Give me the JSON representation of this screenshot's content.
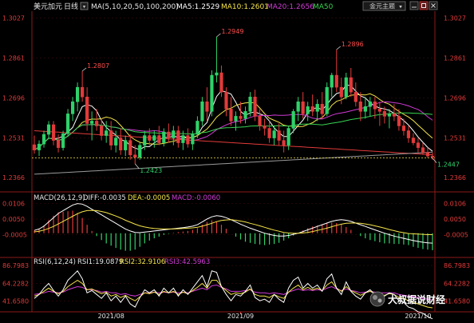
{
  "header": {
    "symbol": "美元加元",
    "period": "日线",
    "ma_label": "MA(5,10,20,50,100,200)",
    "ma5": "MA5:1.2529",
    "ma10": "MA10:1.2601",
    "ma20": "MA20:1.2656",
    "ma50": "MA50",
    "theme_button": "金元主题",
    "colors": {
      "ma5": "#ffffff",
      "ma10": "#f5e44a",
      "ma20": "#d13bd6",
      "ma50": "#39d353"
    }
  },
  "watermark": "大叔据说财经",
  "chart_data": [
    {
      "type": "candlestick",
      "title": "美元加元 日线",
      "x_ticks": [
        "2021/08",
        "2021/09",
        "2021/10"
      ],
      "y_ticks_left": [
        "1.3027",
        "1.2861",
        "1.2696",
        "1.2531",
        "1.2366"
      ],
      "y_ticks_right": [
        "1.3027",
        "1.2861",
        "1.2696",
        "1.2531",
        "1.2366"
      ],
      "ylim": [
        1.232,
        1.3055
      ],
      "annotations": [
        {
          "label": "1.2807",
          "bar": 10
        },
        {
          "label": "1.2423",
          "bar": 21
        },
        {
          "label": "1.2949",
          "bar": 38
        },
        {
          "label": "1.2896",
          "bar": 63
        },
        {
          "label": "1.2447",
          "bar": 83
        }
      ],
      "current_price": 1.2447,
      "candles": [
        [
          1.2502,
          1.254,
          1.2465,
          1.248
        ],
        [
          1.248,
          1.252,
          1.2455,
          1.2505
        ],
        [
          1.2505,
          1.256,
          1.249,
          1.2545
        ],
        [
          1.2545,
          1.26,
          1.2525,
          1.2585
        ],
        [
          1.2585,
          1.26,
          1.25,
          1.252
        ],
        [
          1.252,
          1.2545,
          1.247,
          1.249
        ],
        [
          1.249,
          1.256,
          1.2478,
          1.2548
        ],
        [
          1.2548,
          1.265,
          1.2535,
          1.263
        ],
        [
          1.263,
          1.27,
          1.26,
          1.268
        ],
        [
          1.268,
          1.276,
          1.264,
          1.274
        ],
        [
          1.274,
          1.2807,
          1.268,
          1.27
        ],
        [
          1.27,
          1.274,
          1.256,
          1.259
        ],
        [
          1.259,
          1.264,
          1.252,
          1.26
        ],
        [
          1.26,
          1.265,
          1.256,
          1.258
        ],
        [
          1.258,
          1.261,
          1.252,
          1.254
        ],
        [
          1.254,
          1.26,
          1.251,
          1.256
        ],
        [
          1.256,
          1.26,
          1.248,
          1.25
        ],
        [
          1.25,
          1.256,
          1.247,
          1.253
        ],
        [
          1.253,
          1.257,
          1.246,
          1.248
        ],
        [
          1.248,
          1.254,
          1.2455,
          1.252
        ],
        [
          1.252,
          1.2545,
          1.244,
          1.246
        ],
        [
          1.246,
          1.25,
          1.2423,
          1.245
        ],
        [
          1.245,
          1.251,
          1.244,
          1.25
        ],
        [
          1.25,
          1.256,
          1.248,
          1.254
        ],
        [
          1.254,
          1.257,
          1.25,
          1.252
        ],
        [
          1.252,
          1.256,
          1.249,
          1.254
        ],
        [
          1.254,
          1.258,
          1.25,
          1.251
        ],
        [
          1.251,
          1.257,
          1.2495,
          1.2555
        ],
        [
          1.2555,
          1.259,
          1.251,
          1.253
        ],
        [
          1.253,
          1.258,
          1.25,
          1.256
        ],
        [
          1.256,
          1.258,
          1.249,
          1.251
        ],
        [
          1.251,
          1.256,
          1.248,
          1.254
        ],
        [
          1.254,
          1.257,
          1.249,
          1.2505
        ],
        [
          1.2505,
          1.256,
          1.248,
          1.2545
        ],
        [
          1.2545,
          1.262,
          1.253,
          1.26
        ],
        [
          1.26,
          1.27,
          1.258,
          1.268
        ],
        [
          1.268,
          1.274,
          1.26,
          1.264
        ],
        [
          1.264,
          1.281,
          1.262,
          1.279
        ],
        [
          1.279,
          1.2949,
          1.276,
          1.28
        ],
        [
          1.28,
          1.283,
          1.27,
          1.272
        ],
        [
          1.272,
          1.274,
          1.262,
          1.265
        ],
        [
          1.265,
          1.27,
          1.258,
          1.26
        ],
        [
          1.26,
          1.264,
          1.256,
          1.262
        ],
        [
          1.262,
          1.268,
          1.259,
          1.261
        ],
        [
          1.261,
          1.266,
          1.259,
          1.264
        ],
        [
          1.264,
          1.272,
          1.262,
          1.27
        ],
        [
          1.27,
          1.273,
          1.26,
          1.262
        ],
        [
          1.262,
          1.265,
          1.256,
          1.258
        ],
        [
          1.258,
          1.261,
          1.254,
          1.257
        ],
        [
          1.257,
          1.26,
          1.251,
          1.253
        ],
        [
          1.253,
          1.258,
          1.25,
          1.256
        ],
        [
          1.256,
          1.259,
          1.25,
          1.252
        ],
        [
          1.252,
          1.256,
          1.247,
          1.25
        ],
        [
          1.25,
          1.258,
          1.248,
          1.257
        ],
        [
          1.257,
          1.265,
          1.255,
          1.264
        ],
        [
          1.264,
          1.27,
          1.26,
          1.268
        ],
        [
          1.268,
          1.272,
          1.261,
          1.263
        ],
        [
          1.263,
          1.268,
          1.26,
          1.266
        ],
        [
          1.266,
          1.271,
          1.262,
          1.264
        ],
        [
          1.264,
          1.269,
          1.26,
          1.267
        ],
        [
          1.267,
          1.272,
          1.261,
          1.263
        ],
        [
          1.263,
          1.276,
          1.262,
          1.274
        ],
        [
          1.274,
          1.28,
          1.27,
          1.279
        ],
        [
          1.279,
          1.2896,
          1.272,
          1.274
        ],
        [
          1.274,
          1.278,
          1.267,
          1.27
        ],
        [
          1.27,
          1.28,
          1.269,
          1.278
        ],
        [
          1.278,
          1.282,
          1.27,
          1.272
        ],
        [
          1.272,
          1.276,
          1.266,
          1.268
        ],
        [
          1.268,
          1.272,
          1.26,
          1.264
        ],
        [
          1.264,
          1.27,
          1.261,
          1.266
        ],
        [
          1.266,
          1.27,
          1.262,
          1.268
        ],
        [
          1.268,
          1.27,
          1.261,
          1.265
        ],
        [
          1.265,
          1.268,
          1.258,
          1.264
        ],
        [
          1.264,
          1.266,
          1.259,
          1.262
        ],
        [
          1.262,
          1.265,
          1.257,
          1.263
        ],
        [
          1.263,
          1.267,
          1.26,
          1.262
        ],
        [
          1.262,
          1.265,
          1.256,
          1.258
        ],
        [
          1.258,
          1.261,
          1.254,
          1.256
        ],
        [
          1.256,
          1.258,
          1.251,
          1.253
        ],
        [
          1.253,
          1.255,
          1.25,
          1.251
        ],
        [
          1.251,
          1.253,
          1.247,
          1.249
        ],
        [
          1.249,
          1.251,
          1.246,
          1.247
        ],
        [
          1.247,
          1.249,
          1.2447,
          1.2455
        ],
        [
          1.2455,
          1.247,
          1.244,
          1.245
        ]
      ]
    },
    {
      "type": "line",
      "title": "MACD(26,12,9)",
      "labels": {
        "diff": "DIFF:-0.0035",
        "dea": "DEA:-0.0005",
        "macd": "MACD:-0.0060"
      },
      "y_ticks": [
        "0.0106",
        "0.0050",
        "-0.0005"
      ],
      "ylim": [
        -0.008,
        0.0135
      ],
      "diff": [
        0.001,
        0.0015,
        0.0025,
        0.004,
        0.0055,
        0.007,
        0.008,
        0.009,
        0.01,
        0.0105,
        0.0103,
        0.0095,
        0.0085,
        0.0075,
        0.0065,
        0.0055,
        0.0045,
        0.0035,
        0.0025,
        0.0015,
        0.0008,
        0.0003,
        0.0002,
        0.0004,
        0.0006,
        0.0008,
        0.001,
        0.0012,
        0.0014,
        0.0016,
        0.0018,
        0.002,
        0.0022,
        0.0025,
        0.003,
        0.004,
        0.005,
        0.0058,
        0.0062,
        0.006,
        0.0055,
        0.0048,
        0.004,
        0.0032,
        0.0025,
        0.0018,
        0.0012,
        0.0006,
        0.0,
        -0.0004,
        -0.0008,
        -0.001,
        -0.001,
        -0.0008,
        -0.0004,
        0.0,
        0.0006,
        0.0012,
        0.0018,
        0.0024,
        0.003,
        0.0036,
        0.0042,
        0.0046,
        0.0048,
        0.0046,
        0.0042,
        0.0036,
        0.003,
        0.0024,
        0.0018,
        0.0012,
        0.0006,
        0.0,
        -0.0005,
        -0.001,
        -0.0014,
        -0.0018,
        -0.0022,
        -0.0026,
        -0.0029,
        -0.0032,
        -0.0034,
        -0.0035
      ],
      "dea": [
        0.0005,
        0.0007,
        0.0011,
        0.0017,
        0.0024,
        0.0033,
        0.0042,
        0.0051,
        0.006,
        0.0069,
        0.0076,
        0.008,
        0.0081,
        0.008,
        0.0077,
        0.0073,
        0.0067,
        0.0061,
        0.0054,
        0.0046,
        0.0039,
        0.0032,
        0.0026,
        0.0022,
        0.0019,
        0.0017,
        0.0016,
        0.0015,
        0.0015,
        0.0015,
        0.0016,
        0.0017,
        0.0018,
        0.0019,
        0.0021,
        0.0025,
        0.003,
        0.0035,
        0.0041,
        0.0045,
        0.0047,
        0.0048,
        0.0046,
        0.0043,
        0.004,
        0.0035,
        0.0031,
        0.0026,
        0.0021,
        0.0016,
        0.0011,
        0.0007,
        0.0003,
        0.0001,
        0.0,
        0.0,
        0.0001,
        0.0003,
        0.0006,
        0.001,
        0.0014,
        0.0018,
        0.0023,
        0.0028,
        0.0032,
        0.0035,
        0.0036,
        0.0036,
        0.0035,
        0.0033,
        0.003,
        0.0026,
        0.0022,
        0.0018,
        0.0013,
        0.0009,
        0.0005,
        0.0002,
        -0.0001,
        -0.0002,
        -0.0003,
        -0.0004,
        -0.0005,
        -0.0005
      ]
    },
    {
      "type": "line",
      "title": "RSI(6,12,24)",
      "labels": {
        "rsi1": "RSI1:19.0879",
        "rsi2": "RSI2:32.9106",
        "rsi3": "RSI3:42.5963"
      },
      "y_ticks": [
        "86.7983",
        "64.2282",
        "41.6580"
      ],
      "ylim": [
        30,
        95
      ],
      "rsi1": [
        45,
        50,
        58,
        64,
        55,
        48,
        56,
        68,
        74,
        80,
        70,
        52,
        55,
        50,
        45,
        52,
        42,
        48,
        40,
        48,
        38,
        34,
        46,
        56,
        52,
        56,
        48,
        58,
        52,
        58,
        48,
        56,
        50,
        58,
        66,
        74,
        60,
        80,
        78,
        60,
        50,
        42,
        50,
        48,
        54,
        62,
        46,
        42,
        44,
        40,
        50,
        44,
        40,
        58,
        68,
        72,
        58,
        64,
        58,
        62,
        54,
        70,
        76,
        58,
        50,
        66,
        54,
        48,
        44,
        52,
        56,
        50,
        46,
        48,
        52,
        50,
        42,
        40,
        34,
        32,
        28,
        26,
        22,
        19
      ],
      "rsi2": [
        48,
        50,
        54,
        58,
        54,
        51,
        54,
        60,
        64,
        68,
        64,
        56,
        57,
        54,
        51,
        53,
        48,
        50,
        46,
        49,
        45,
        42,
        47,
        52,
        51,
        53,
        50,
        54,
        52,
        54,
        50,
        53,
        51,
        55,
        59,
        64,
        58,
        68,
        68,
        60,
        55,
        50,
        52,
        51,
        53,
        57,
        50,
        48,
        48,
        46,
        50,
        47,
        45,
        53,
        58,
        62,
        56,
        59,
        56,
        58,
        55,
        62,
        66,
        58,
        54,
        60,
        55,
        52,
        49,
        52,
        54,
        51,
        49,
        49,
        51,
        50,
        46,
        45,
        42,
        40,
        38,
        36,
        34,
        33
      ],
      "rsi3": [
        50,
        51,
        52,
        54,
        53,
        52,
        53,
        56,
        58,
        60,
        59,
        56,
        56,
        55,
        53,
        54,
        52,
        52,
        50,
        51,
        49,
        48,
        50,
        52,
        52,
        53,
        52,
        53,
        52,
        53,
        52,
        53,
        52,
        54,
        56,
        58,
        56,
        61,
        62,
        59,
        57,
        54,
        54,
        54,
        55,
        56,
        53,
        52,
        52,
        51,
        52,
        51,
        50,
        53,
        55,
        57,
        55,
        56,
        55,
        56,
        55,
        58,
        60,
        57,
        55,
        57,
        55,
        54,
        52,
        53,
        54,
        53,
        52,
        52,
        52,
        52,
        50,
        49,
        48,
        47,
        46,
        45,
        44,
        43
      ]
    }
  ]
}
